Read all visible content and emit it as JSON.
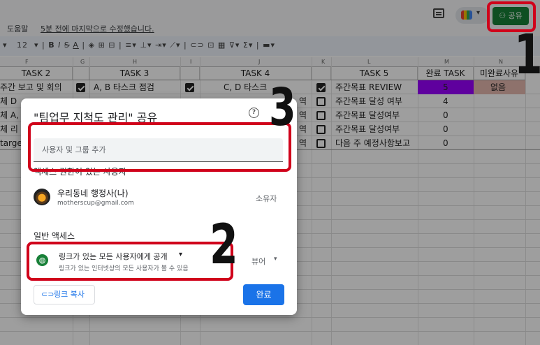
{
  "topbar": {
    "menu_help": "도움말",
    "last_edit": "5분 전에 마지막으로 수정했습니다.",
    "share_label": "공유"
  },
  "toolbar": {
    "font_size": "12"
  },
  "columns": [
    "F",
    "G",
    "H",
    "I",
    "J",
    "K",
    "L",
    "M",
    "N"
  ],
  "headers": {
    "task2": "TASK 2",
    "task3": "TASK 3",
    "task4": "TASK 4",
    "task5": "TASK 5",
    "done_task": "완료 TASK",
    "not_done_reason": "미완료사유"
  },
  "rows": [
    {
      "task2": "주간 보고 및 회의",
      "task3": "A, B 타스크 점검",
      "task4": "C, D 타스크",
      "task5": "주간목표 REVIEW",
      "count": "5",
      "reason": "없음"
    },
    {
      "task2": "체 D",
      "task3": "",
      "task4": "역",
      "task5": "주간목표 달성 여부",
      "count": "4",
      "reason": ""
    },
    {
      "task2": "체 A,",
      "task3": "",
      "task4": "역",
      "task5": "주간목표 달성여부",
      "count": "0",
      "reason": ""
    },
    {
      "task2": "체 리",
      "task3": "",
      "task4": "역",
      "task5": "주간목표 달성여부",
      "count": "0",
      "reason": ""
    },
    {
      "task2": "target",
      "task3": "",
      "task4": "역",
      "task5": "다음 주 예정사항보고",
      "count": "0",
      "reason": ""
    }
  ],
  "dialog": {
    "title": "\"팀업무 지척도 관리\" 공유",
    "add_placeholder": "사용자 및 그룹 추가",
    "access_label": "액세스 권한이 있는 사용자",
    "user_name": "우리동네 행정사(나)",
    "user_email": "motherscup@gmail.com",
    "owner_label": "소유자",
    "general_label": "일반 액세스",
    "link_option": "링크가 있는 모든 사용자에게 공개",
    "link_desc": "링크가 있는 인터넷상의 모든 사용자가 볼 수 있음",
    "role": "뷰어",
    "copy_link": "링크 복사",
    "done": "완료"
  },
  "annotations": [
    "1",
    "2",
    "3"
  ],
  "colors": {
    "share_green": "#188038",
    "done_blue": "#1a73e8",
    "highlight_purple": "#9900ff",
    "highlight_pink": "#e6b8af",
    "annotation_red": "#d0021b"
  }
}
